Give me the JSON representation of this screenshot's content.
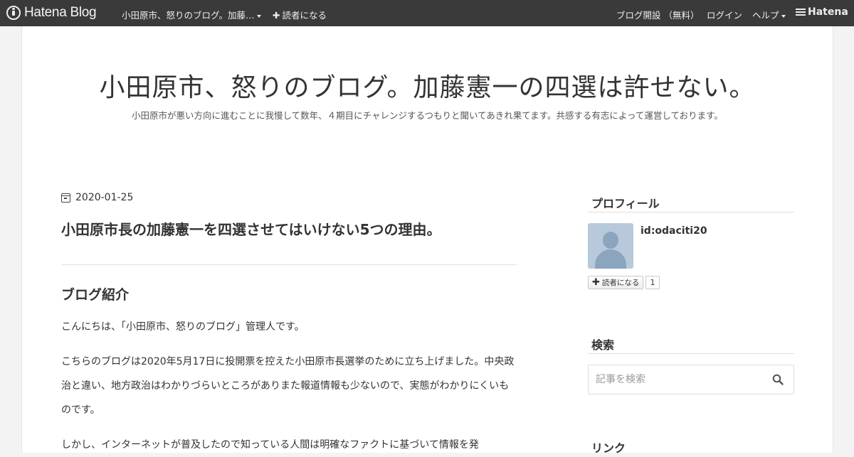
{
  "topbar": {
    "logo_text": "Hatena Blog",
    "blog_menu": "小田原市、怒りのブログ。加藤…",
    "subscribe": "読者になる",
    "create_blog": "ブログ開設 （無料）",
    "login": "ログイン",
    "help": "ヘルプ",
    "hatena": "Hatena"
  },
  "blog": {
    "title": "小田原市、怒りのブログ。加藤憲一の四選は許せない。",
    "description": "小田原市が悪い方向に進むことに我慢して数年、４期目にチャレンジするつもりと聞いてあきれ果てます。共感する有志によって運営しております。"
  },
  "article": {
    "date": "2020-01-25",
    "title": "小田原市長の加藤憲一を四選させてはいけない5つの理由。",
    "section_heading": "ブログ紹介",
    "paragraphs": [
      "こんにちは、「小田原市、怒りのブログ」管理人です。",
      "こちらのブログは2020年5月17日に投開票を控えた小田原市長選挙のために立ち上げました。中央政治と違い、地方政治はわかりづらいところがありまた報道情報も少ないので、実態がわかりにくいものです。",
      "しかし、インターネットが普及したので知っている人間は明確なファクトに基づいて情報を発"
    ]
  },
  "sidebar": {
    "profile_heading": "プロフィール",
    "user_id": "id:odaciti20",
    "subscribe_button": "読者になる",
    "subscriber_count": "1",
    "search_heading": "検索",
    "search_placeholder": "記事を検索",
    "links_heading": "リンク"
  },
  "colors": {
    "topbar_bg": "#3a3a3a",
    "page_bg": "#ffffff",
    "outer_bg": "#f3f3f3"
  }
}
